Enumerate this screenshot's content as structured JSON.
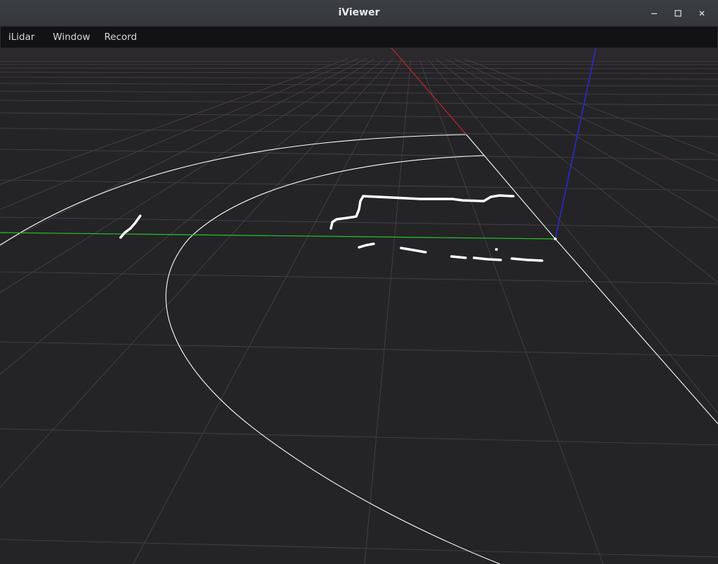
{
  "window": {
    "title": "iViewer",
    "controls": {
      "minimize_icon": "minimize-icon",
      "maximize_icon": "maximize-icon",
      "close_icon": "close-icon"
    }
  },
  "menubar": {
    "items": [
      {
        "label": "iLidar"
      },
      {
        "label": "Window"
      },
      {
        "label": "Record"
      }
    ]
  },
  "viewport": {
    "background_color": "#242427",
    "grid_color": "#5a4448",
    "axis_colors": {
      "x_axis": "#c0262a",
      "y_axis": "#27c227",
      "z_axis": "#2a2ad0"
    },
    "point_color": "#ffffff",
    "range_ring_color": "#ffffff"
  }
}
